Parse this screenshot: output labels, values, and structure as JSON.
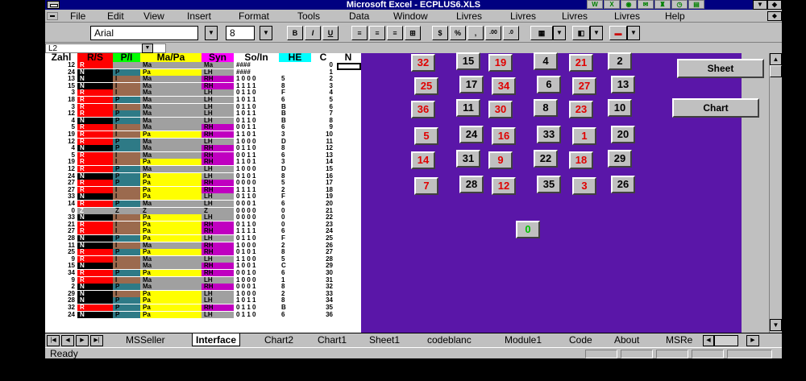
{
  "window": {
    "title": "Microsoft Excel - ECPLUS6.XLS"
  },
  "menu": [
    "File",
    "Edit",
    "View",
    "Insert",
    "Format",
    "Tools",
    "Data",
    "Window",
    "Livres",
    "Livres",
    "Livres",
    "Livres",
    "Help"
  ],
  "toolbar": {
    "font": "Arial",
    "size": "8",
    "bold": "B",
    "italic": "I",
    "underline": "U",
    "currency": "$",
    "percent": "%",
    "comma": ",",
    "dec_inc": ".00",
    "dec_dec": ".0"
  },
  "formula": {
    "namebox": "L2"
  },
  "columns": [
    "Zahl",
    "R/S",
    "P/I",
    "Ma/Pa",
    "Syn",
    "So/In",
    "HE",
    "C",
    "N"
  ],
  "rows": [
    [
      "12",
      "R",
      "",
      "Ma",
      "Ma",
      "####",
      "",
      "0"
    ],
    [
      "24",
      "N",
      "P",
      "Pa",
      "LH",
      "####",
      "",
      "1"
    ],
    [
      "13",
      "N",
      "I",
      "Ma",
      "RH",
      "1 0 0 0",
      "5",
      "2"
    ],
    [
      "15",
      "N",
      "I",
      "Ma",
      "RH",
      "1 1 1 1",
      "8",
      "3"
    ],
    [
      "3",
      "R",
      "I",
      "Ma",
      "LH",
      "0 1 1 0",
      "F",
      "4"
    ],
    [
      "18",
      "R",
      "P",
      "Ma",
      "LH",
      "1 0 1 1",
      "6",
      "5"
    ],
    [
      "3",
      "R",
      "I",
      "Ma",
      "LH",
      "0 1 1 0",
      "B",
      "6"
    ],
    [
      "12",
      "R",
      "P",
      "Ma",
      "LH",
      "1 0 1 1",
      "B",
      "7"
    ],
    [
      "4",
      "N",
      "P",
      "Ma",
      "LH",
      "0 1 1 0",
      "B",
      "8"
    ],
    [
      "5",
      "R",
      "I",
      "Ma",
      "RH",
      "0 0 1 1",
      "6",
      "9"
    ],
    [
      "19",
      "R",
      "I",
      "Pa",
      "RH",
      "1 1 0 1",
      "3",
      "10"
    ],
    [
      "12",
      "R",
      "P",
      "Ma",
      "LH",
      "1 0 0 0",
      "D",
      "11"
    ],
    [
      "4",
      "N",
      "P",
      "Ma",
      "RH",
      "0 1 1 0",
      "8",
      "12"
    ],
    [
      "5",
      "R",
      "I",
      "Ma",
      "RH",
      "0 0 1 1",
      "6",
      "13"
    ],
    [
      "19",
      "R",
      "I",
      "Pa",
      "RH",
      "1 1 0 1",
      "3",
      "14"
    ],
    [
      "12",
      "R",
      "P",
      "Ma",
      "LH",
      "1 0 0 0",
      "D",
      "15"
    ],
    [
      "24",
      "N",
      "P",
      "Pa",
      "LH",
      "0 1 0 1",
      "8",
      "16"
    ],
    [
      "27",
      "R",
      "P",
      "Pa",
      "RH",
      "0 0 0 0",
      "5",
      "17"
    ],
    [
      "27",
      "R",
      "I",
      "Pa",
      "RH",
      "1 1 1 1",
      "2",
      "18"
    ],
    [
      "33",
      "N",
      "I",
      "Pa",
      "LH",
      "0 1 1 0",
      "F",
      "19"
    ],
    [
      "14",
      "R",
      "P",
      "Ma",
      "LH",
      "0 0 0 1",
      "6",
      "20"
    ],
    [
      "0",
      "Z",
      "Z",
      "Z",
      "Z",
      "0 0 0 0",
      "0",
      "21"
    ],
    [
      "33",
      "N",
      "I",
      "Pa",
      "LH",
      "0 0 0 0",
      "0",
      "22"
    ],
    [
      "21",
      "R",
      "I",
      "Pa",
      "RH",
      "0 1 1 0",
      "0",
      "23"
    ],
    [
      "27",
      "R",
      "I",
      "Pa",
      "RH",
      "1 1 1 1",
      "6",
      "24"
    ],
    [
      "28",
      "N",
      "P",
      "Pa",
      "LH",
      "0 1 1 0",
      "F",
      "25"
    ],
    [
      "11",
      "N",
      "I",
      "Ma",
      "RH",
      "1 0 0 0",
      "2",
      "26"
    ],
    [
      "25",
      "R",
      "P",
      "Pa",
      "RH",
      "0 1 0 1",
      "8",
      "27"
    ],
    [
      "9",
      "R",
      "I",
      "Ma",
      "LH",
      "1 1 0 0",
      "5",
      "28"
    ],
    [
      "15",
      "N",
      "I",
      "Ma",
      "RH",
      "1 0 0 1",
      "C",
      "29"
    ],
    [
      "34",
      "R",
      "P",
      "Pa",
      "RH",
      "0 0 1 0",
      "6",
      "30"
    ],
    [
      "9",
      "R",
      "I",
      "Ma",
      "LH",
      "1 0 0 0",
      "1",
      "31"
    ],
    [
      "2",
      "N",
      "P",
      "Ma",
      "RH",
      "0 0 0 1",
      "8",
      "32"
    ],
    [
      "29",
      "N",
      "I",
      "Pa",
      "LH",
      "1 0 0 0",
      "2",
      "33"
    ],
    [
      "28",
      "N",
      "P",
      "Pa",
      "LH",
      "1 0 1 1",
      "8",
      "34"
    ],
    [
      "32",
      "R",
      "P",
      "Pa",
      "RH",
      "0 1 1 0",
      "B",
      "35"
    ],
    [
      "24",
      "N",
      "P",
      "Pa",
      "LH",
      "0 1 1 0",
      "6",
      "36"
    ]
  ],
  "number_buttons": [
    {
      "v": "32",
      "c": "red"
    },
    {
      "v": "15",
      "c": "black"
    },
    {
      "v": "19",
      "c": "red"
    },
    {
      "v": "4",
      "c": "black"
    },
    {
      "v": "21",
      "c": "red"
    },
    {
      "v": "2",
      "c": "black"
    },
    {
      "v": "25",
      "c": "red"
    },
    {
      "v": "17",
      "c": "black"
    },
    {
      "v": "34",
      "c": "red"
    },
    {
      "v": "6",
      "c": "black"
    },
    {
      "v": "27",
      "c": "red"
    },
    {
      "v": "13",
      "c": "black"
    },
    {
      "v": "36",
      "c": "red"
    },
    {
      "v": "11",
      "c": "black"
    },
    {
      "v": "30",
      "c": "red"
    },
    {
      "v": "8",
      "c": "black"
    },
    {
      "v": "23",
      "c": "red"
    },
    {
      "v": "10",
      "c": "black"
    },
    {
      "v": "5",
      "c": "red"
    },
    {
      "v": "24",
      "c": "black"
    },
    {
      "v": "16",
      "c": "red"
    },
    {
      "v": "33",
      "c": "black"
    },
    {
      "v": "1",
      "c": "red"
    },
    {
      "v": "20",
      "c": "black"
    },
    {
      "v": "14",
      "c": "red"
    },
    {
      "v": "31",
      "c": "black"
    },
    {
      "v": "9",
      "c": "red"
    },
    {
      "v": "22",
      "c": "black"
    },
    {
      "v": "18",
      "c": "red"
    },
    {
      "v": "29",
      "c": "black"
    },
    {
      "v": "7",
      "c": "red"
    },
    {
      "v": "28",
      "c": "black"
    },
    {
      "v": "12",
      "c": "red"
    },
    {
      "v": "35",
      "c": "black"
    },
    {
      "v": "3",
      "c": "red"
    },
    {
      "v": "26",
      "c": "black"
    }
  ],
  "zero_button": {
    "v": "0",
    "c": "green"
  },
  "buttons": {
    "sheet": "Sheet",
    "chart": "Chart"
  },
  "tabs": [
    "MSSeller",
    "Interface",
    "Chart2",
    "Chart1",
    "Sheet1",
    "codeblanc",
    "Module1",
    "Code",
    "About",
    "MSRe"
  ],
  "active_tab": "Interface",
  "status": "Ready",
  "colors": {
    "red": "#ff0000",
    "black": "#000000",
    "teal": "#2e7a86",
    "brown": "#9b6a4e",
    "gray": "#a0a0a0",
    "yellow": "#ffff00",
    "magenta": "#c000c0",
    "purple": "#5a16a8",
    "cyan": "#00ffff"
  }
}
